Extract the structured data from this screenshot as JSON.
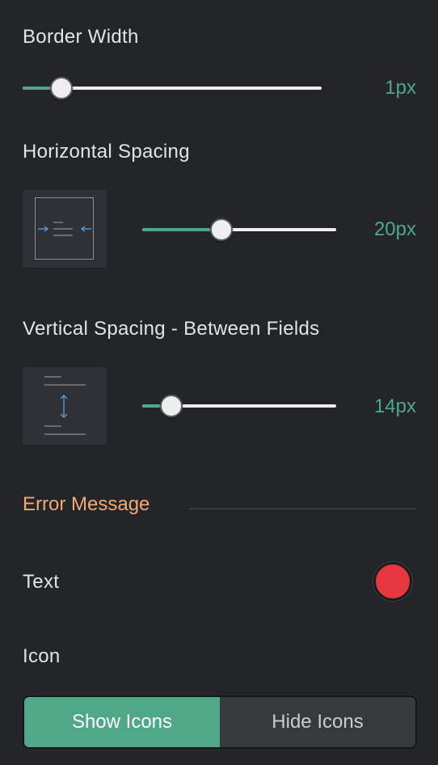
{
  "border_width": {
    "label": "Border Width",
    "value_text": "1px",
    "level": 0.13
  },
  "horizontal_spacing": {
    "label": "Horizontal Spacing",
    "value_text": "20px",
    "level": 0.41,
    "icon": "horizontal-spacing-icon"
  },
  "vertical_spacing": {
    "label": "Vertical Spacing - Between Fields",
    "value_text": "14px",
    "level": 0.15,
    "icon": "vertical-spacing-icon"
  },
  "error_message": {
    "title": "Error Message",
    "text_label": "Text",
    "text_color": "#e5373d",
    "icon_label": "Icon",
    "icon_options": [
      {
        "label": "Show Icons",
        "selected": true
      },
      {
        "label": "Hide Icons",
        "selected": false
      }
    ]
  },
  "colors": {
    "accent": "#4fa888",
    "section_title": "#f2a978",
    "background": "#232528"
  }
}
